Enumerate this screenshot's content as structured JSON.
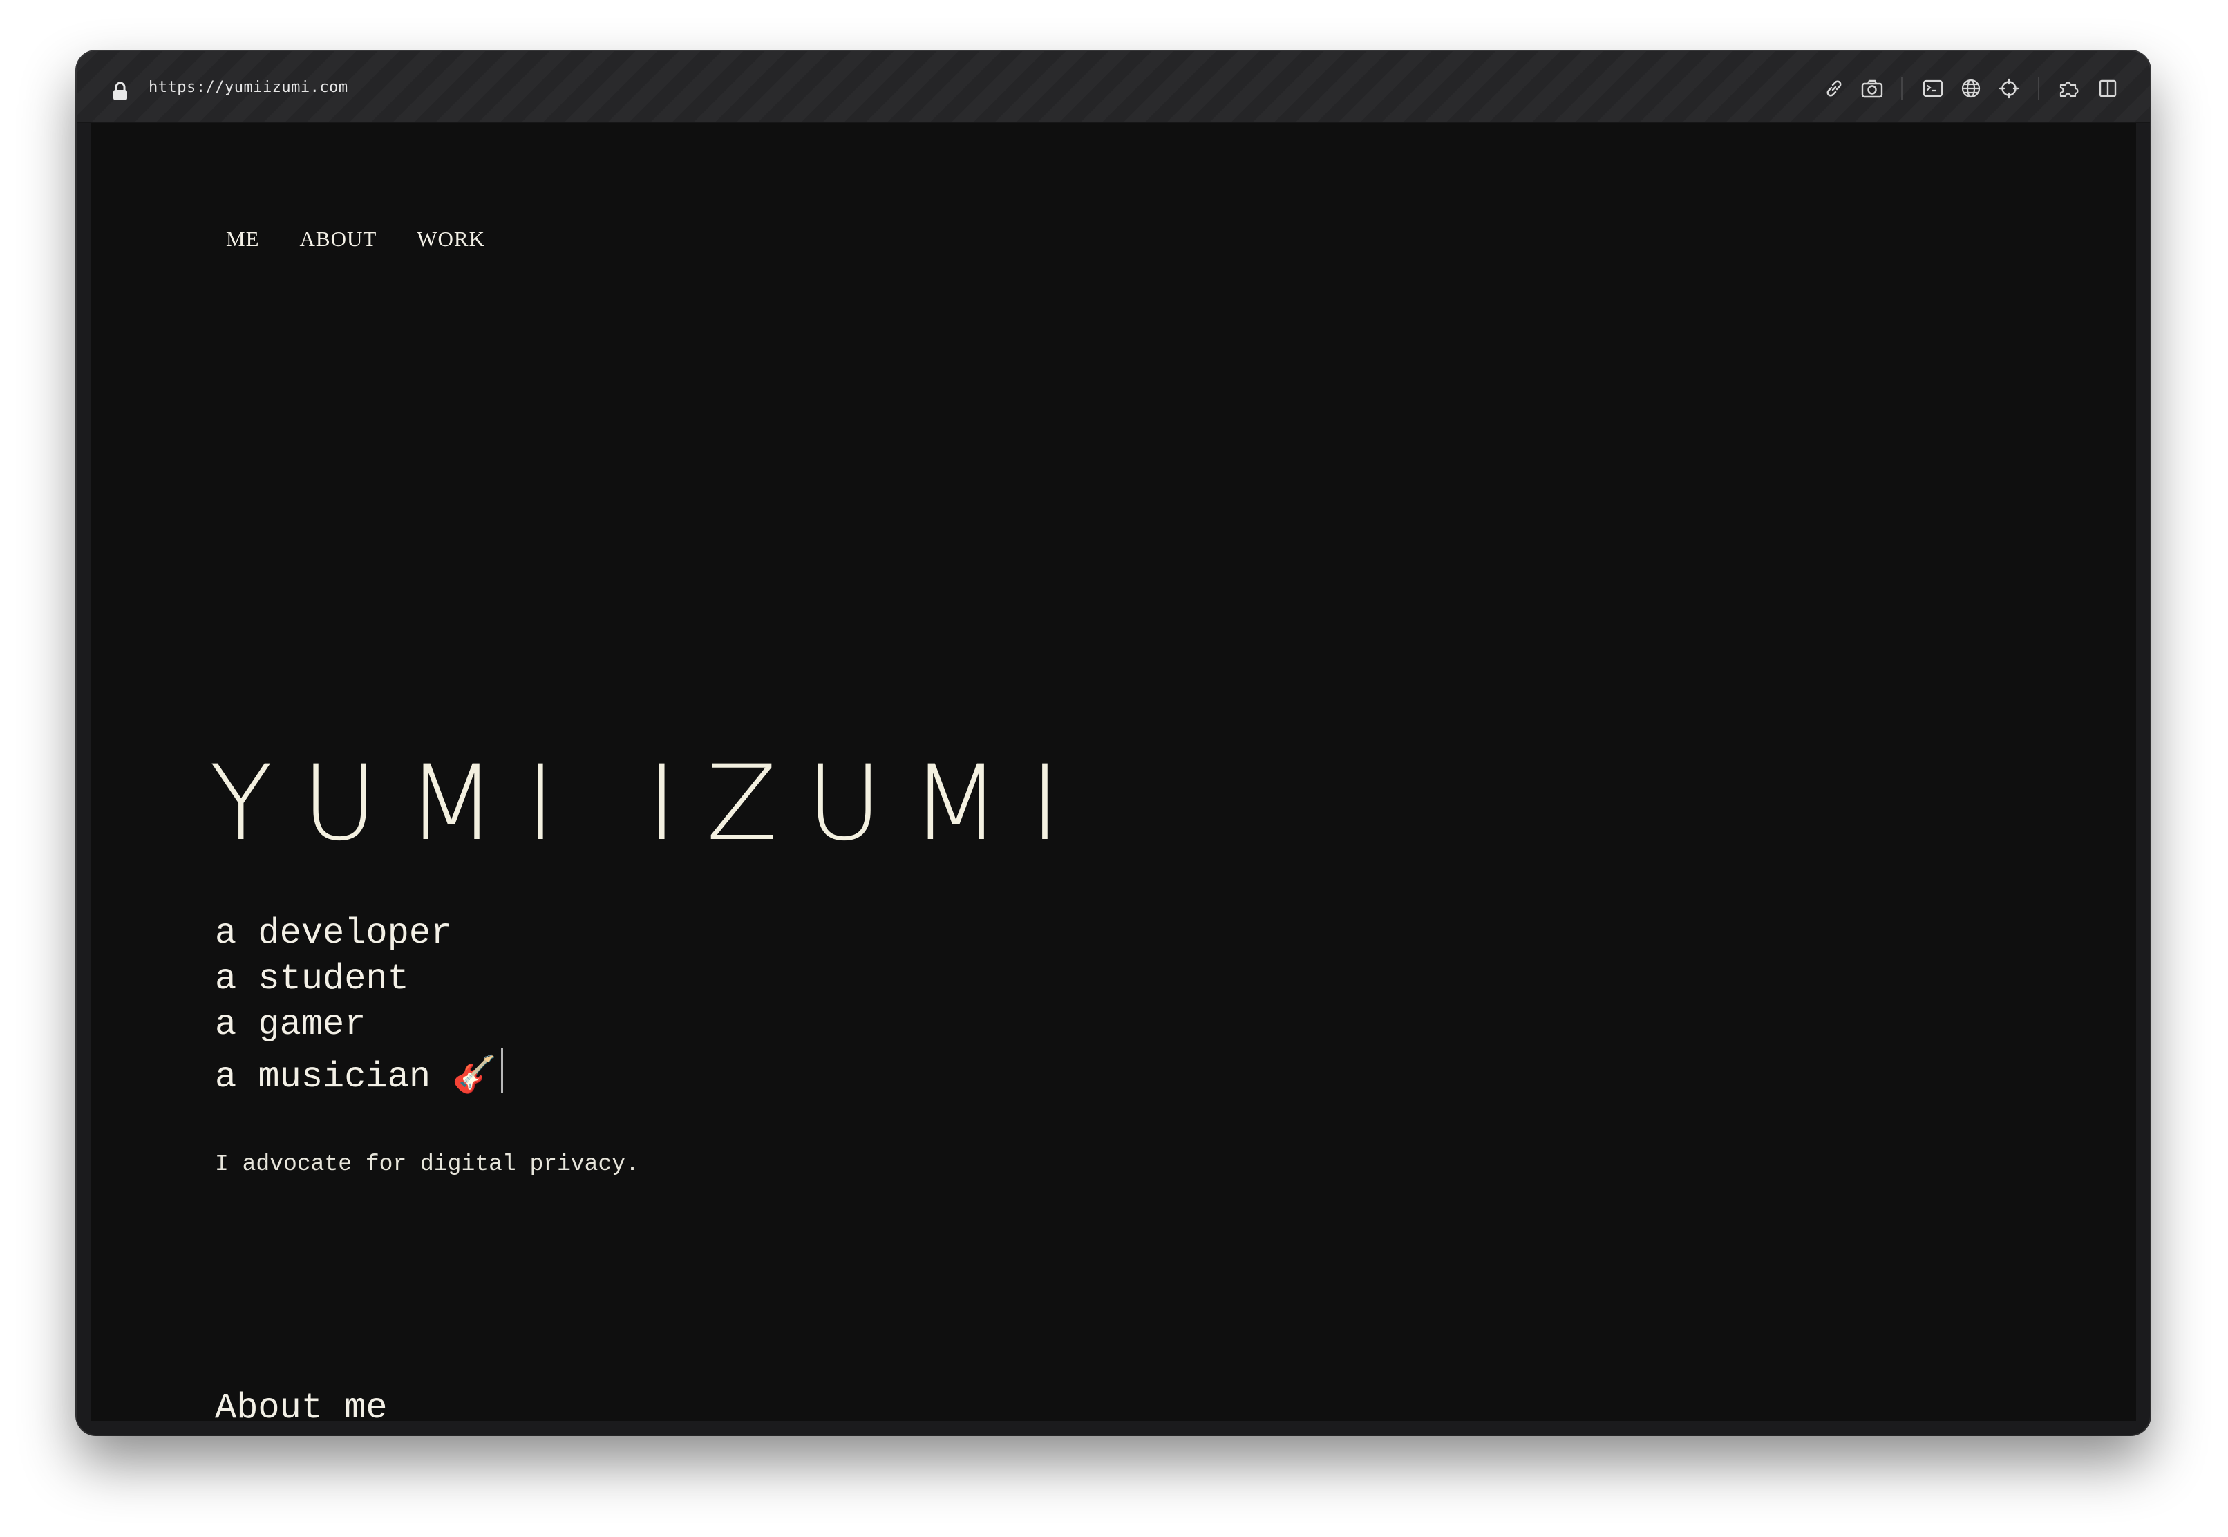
{
  "browser": {
    "url": "https://yumiizumi.com",
    "icons": [
      "lock-icon",
      "link-icon",
      "camera-icon",
      "terminal-icon",
      "globe-icon",
      "crosshair-icon",
      "puzzle-icon",
      "sidebar-icon"
    ]
  },
  "nav": {
    "items": [
      "ME",
      "ABOUT",
      "WORK"
    ]
  },
  "hero": {
    "name": "YUMI IZUMI",
    "roles": [
      "a developer",
      "a student",
      "a gamer",
      "a musician 🎸"
    ],
    "tagline": "I advocate for digital privacy."
  },
  "about": {
    "heading": "About me"
  },
  "colors": {
    "background": "#0f0f0f",
    "text": "#f3f0e6",
    "toolbar": "#2a2a2c"
  }
}
